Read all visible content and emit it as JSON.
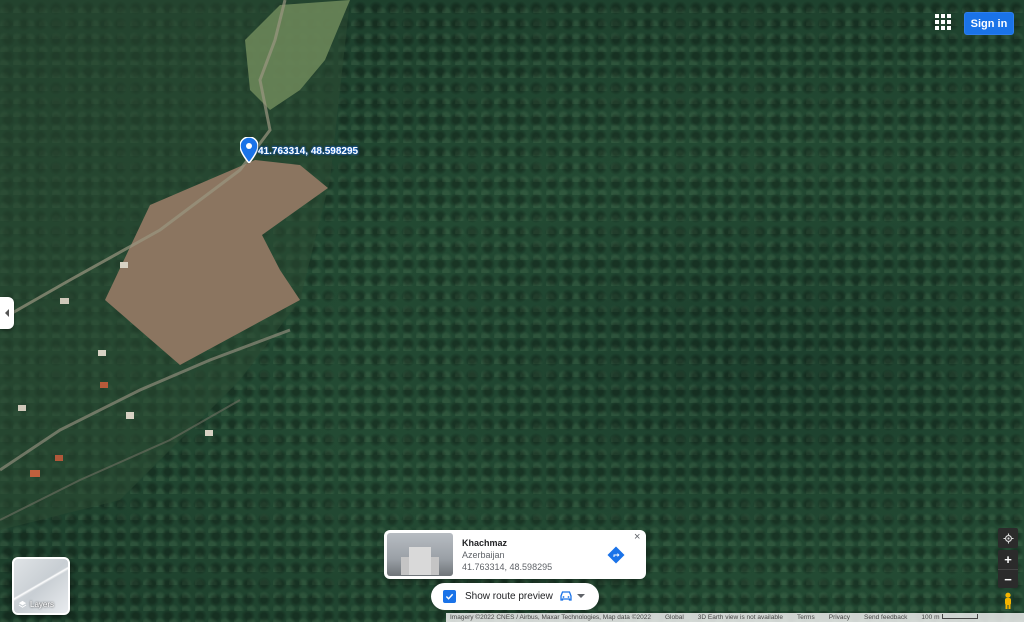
{
  "marker": {
    "label": "41.763314, 48.598295",
    "icon": "location-pin-icon",
    "color": "#1a73e8"
  },
  "header": {
    "apps_icon": "apps-grid-icon",
    "sign_in_label": "Sign in"
  },
  "layers": {
    "label": "Layers",
    "icon": "layers-icon"
  },
  "place_card": {
    "name": "Khachmaz",
    "country": "Azerbaijan",
    "coords": "41.763314, 48.598295",
    "directions_icon": "directions-icon",
    "close_label": "×"
  },
  "route_preview": {
    "label": "Show route preview",
    "checked": true,
    "mode_icon": "car-icon"
  },
  "controls": {
    "location_icon": "my-location-icon",
    "zoom_in": "+",
    "zoom_out": "−",
    "pegman_icon": "pegman-icon"
  },
  "footer": {
    "imagery": "Imagery ©2022 CNES / Airbus, Maxar Technologies, Map data ©2022",
    "global": "Global",
    "earth_view": "3D Earth view is not available",
    "terms": "Terms",
    "privacy": "Privacy",
    "feedback": "Send feedback",
    "scale": "100 m"
  },
  "colors": {
    "accent": "#1a73e8",
    "forest": "#1f3a2b"
  }
}
